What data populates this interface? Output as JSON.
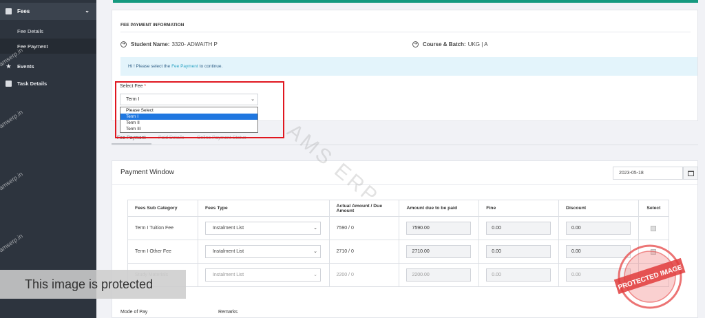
{
  "sidebar": {
    "fees": "Fees",
    "fee_details": "Fee Details",
    "fee_payment": "Fee Payment",
    "events": "Events",
    "task_details": "Task Details",
    "watermark": "amserp.in"
  },
  "info": {
    "title": "FEE PAYMENT INFORMATION",
    "student_label": "Student Name:",
    "student_value": "3320- ADWAITH P",
    "course_label": "Course & Batch:",
    "course_value": "UKG | A",
    "alert_pre": "Hi !  Please select the",
    "alert_link": "Fee Payment",
    "alert_post": "to continue."
  },
  "select_fee": {
    "label": "Select Fee",
    "required": "*",
    "value": "Term I",
    "options": [
      "Please Select",
      "Term I",
      "Term II",
      "Term III"
    ]
  },
  "tabs": [
    "Fee Payment",
    "Paid Details",
    "Online Payment Status"
  ],
  "payment": {
    "title": "Payment Window",
    "date": "2023-05-18",
    "columns": [
      "Fees Sub Category",
      "Fees Type",
      "Actual Amount / Due Amount",
      "Amount due to be paid",
      "Fine",
      "Discount",
      "Select"
    ],
    "rows": [
      {
        "category": "Term I Tuition Fee",
        "type": "Instalment List",
        "actual": "7590 / 0",
        "due": "7590.00",
        "fine": "0.00",
        "discount": "0.00"
      },
      {
        "category": "Term I Other Fee",
        "type": "Instalment List",
        "actual": "2710 / 0",
        "due": "2710.00",
        "fine": "0.00",
        "discount": "0.00"
      },
      {
        "category": "Study Materials",
        "type": "Instalment List",
        "actual": "2200 / 0",
        "due": "2200.00",
        "fine": "0.00",
        "discount": "0.00"
      }
    ],
    "mode_of_pay": "Mode of Pay",
    "remarks": "Remarks"
  },
  "overlay": {
    "protected_text": "This image is protected",
    "watermark": "AMS ERP",
    "stamp_text": "PROTECTED IMAGE"
  }
}
